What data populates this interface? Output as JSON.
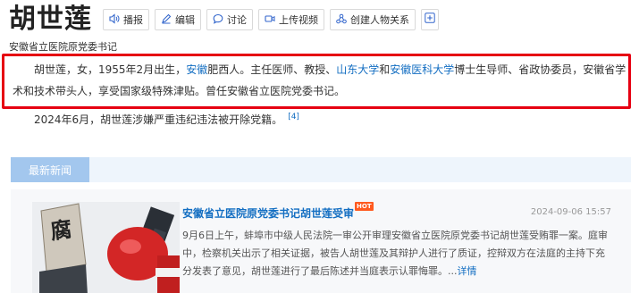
{
  "header": {
    "title": "胡世莲",
    "buttons": [
      {
        "label": "播报",
        "icon": "speaker-icon"
      },
      {
        "label": "编辑",
        "icon": "pencil-icon"
      },
      {
        "label": "讨论",
        "icon": "chat-bubble-icon"
      },
      {
        "label": "上传视频",
        "icon": "video-camera-icon"
      },
      {
        "label": "创建人物关系",
        "icon": "relationship-icon"
      },
      {
        "label": "",
        "icon": "plus-icon"
      }
    ]
  },
  "subtitle": "安徽省立医院原党委书记",
  "intro": {
    "p1_a": "胡世莲，女，1955年2月出生，",
    "p1_link1": "安徽",
    "p1_b": "肥西人。主任医师、教授、",
    "p1_link2": "山东大学",
    "p1_c": "和",
    "p1_link3": "安徽医科大学",
    "p1_d": "博士生导师、省政协委员，安徽省学术和技术带头人，享受国家级特殊津贴。曾任安徽省立医院党委书记。",
    "p2": "2024年6月，胡世莲涉嫌严重违纪违法被开除党籍。",
    "p2_ref": "[4]"
  },
  "highlight_color": "#e60012",
  "news": {
    "tab_label": "最新新闻",
    "item": {
      "title": "安徽省立医院原党委书记胡世莲受审",
      "badge": "HOT",
      "date": "2024-09-06 15:57",
      "body": "9月6日上午，蚌埠市中级人民法院一审公开审理安徽省立医院原党委书记胡世莲受贿罪一案。庭审中，检察机关出示了相关证据，被告人胡世莲及其辩护人进行了质证，控辩双方在法庭的主持下充分发表了意见，胡世莲进行了最后陈述并当庭表示认罪悔罪。...",
      "more_label": "详情",
      "thumb_text": "腐"
    }
  }
}
